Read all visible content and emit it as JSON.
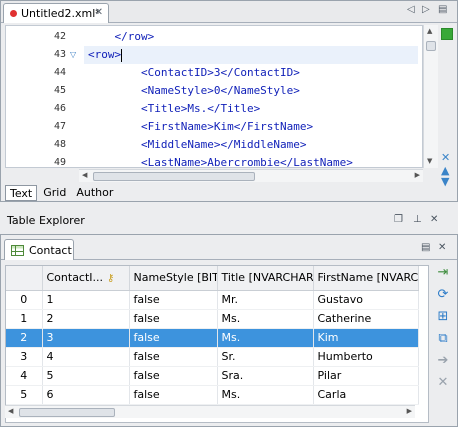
{
  "editor": {
    "tab_label": "Untitled2.xml*",
    "lines": [
      {
        "num": "42",
        "text": "    </row>"
      },
      {
        "num": "43",
        "text": "<row>",
        "current": true
      },
      {
        "num": "44",
        "text": "        <ContactID>3</ContactID>"
      },
      {
        "num": "45",
        "text": "        <NameStyle>0</NameStyle>"
      },
      {
        "num": "46",
        "text": "        <Title>Ms.</Title>"
      },
      {
        "num": "47",
        "text": "        <FirstName>Kim</FirstName>"
      },
      {
        "num": "48",
        "text": "        <MiddleName></MiddleName>"
      },
      {
        "num": "49",
        "text": "        <LastName>Abercrombie</LastName>"
      }
    ],
    "modes": [
      "Text",
      "Grid",
      "Author"
    ],
    "active_mode": "Text",
    "colors": {
      "tag": "#0f1fb8",
      "status_ok": "#38a838",
      "modified_dot": "#e03030"
    }
  },
  "table_explorer": {
    "title": "Table Explorer",
    "tab_label": "Contact",
    "columns": [
      "",
      "ContactI...",
      "NameStyle [BIT]",
      "Title [NVARCHAR]",
      "FirstName [NVARCH"
    ],
    "rows": [
      [
        "0",
        "1",
        "false",
        "Mr.",
        "Gustavo"
      ],
      [
        "1",
        "2",
        "false",
        "Ms.",
        "Catherine"
      ],
      [
        "2",
        "3",
        "false",
        "Ms.",
        "Kim"
      ],
      [
        "3",
        "4",
        "false",
        "Sr.",
        "Humberto"
      ],
      [
        "4",
        "5",
        "false",
        "Sra.",
        "Pilar"
      ],
      [
        "5",
        "6",
        "false",
        "Ms.",
        "Carla"
      ]
    ],
    "selected_row": 2,
    "colors": {
      "selection": "#3d93dd"
    }
  }
}
